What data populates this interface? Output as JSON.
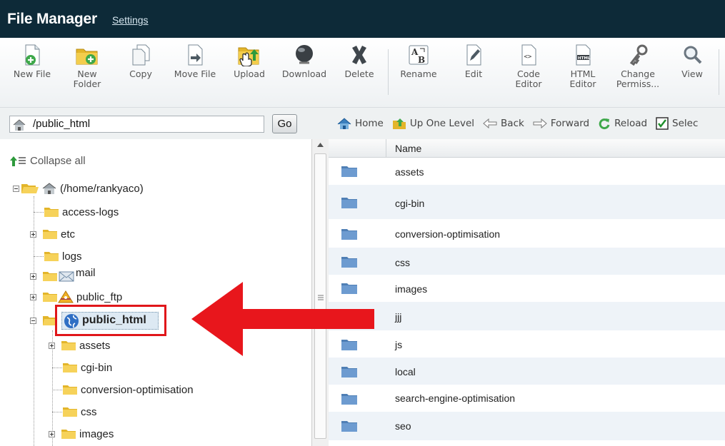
{
  "header": {
    "title": "File Manager",
    "settings_link": "Settings"
  },
  "toolbar": {
    "new_file": "New File",
    "new_folder": [
      "New",
      "Folder"
    ],
    "copy": "Copy",
    "move_file": "Move File",
    "upload": "Upload",
    "download": "Download",
    "delete": "Delete",
    "rename": "Rename",
    "edit": "Edit",
    "code_editor": [
      "Code",
      "Editor"
    ],
    "html_editor": [
      "HTML",
      "Editor"
    ],
    "change_permissions": [
      "Change",
      "Permiss..."
    ],
    "view": "View"
  },
  "path_bar": {
    "value": "/public_html",
    "go_label": "Go"
  },
  "tree": {
    "collapse_all": "Collapse all",
    "root": "(/home/rankyaco)",
    "items": {
      "access_logs": "access-logs",
      "etc": "etc",
      "logs": "logs",
      "mail": "mail",
      "public_ftp": "public_ftp",
      "public_html": "public_html",
      "assets": "assets",
      "cgi_bin": "cgi-bin",
      "conversion_optimisation": "conversion-optimisation",
      "css": "css",
      "images": "images"
    }
  },
  "nav": {
    "home": "Home",
    "up_one_level": "Up One Level",
    "back": "Back",
    "forward": "Forward",
    "reload": "Reload",
    "select": "Selec"
  },
  "file_list": {
    "name_header": "Name",
    "rows": [
      "assets",
      "cgi-bin",
      "conversion-optimisation",
      "css",
      "images",
      "jjj",
      "js",
      "local",
      "search-engine-optimisation",
      "seo"
    ]
  },
  "colors": {
    "header_bg": "#0d2a38",
    "highlight_border": "#e0161a",
    "arrow": "#e8161c",
    "folder_blue": "#5f8fc4"
  },
  "icons": [
    "new-file-icon",
    "new-folder-icon",
    "copy-icon",
    "move-file-icon",
    "upload-icon",
    "download-icon",
    "delete-icon",
    "rename-icon",
    "edit-icon",
    "code-editor-icon",
    "html-editor-icon",
    "change-permissions-icon",
    "view-icon",
    "home-icon",
    "folder-icon",
    "mail-icon",
    "ftp-icon",
    "globe-icon"
  ]
}
